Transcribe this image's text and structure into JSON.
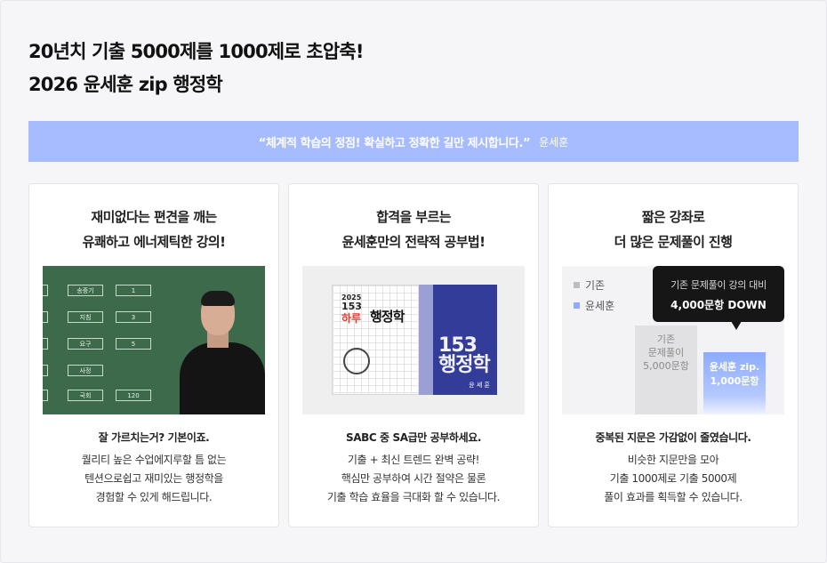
{
  "headline": {
    "line1": "20년치 기출 5000제를 1000제로 초압축!",
    "line2": "2026 윤세훈 zip 행정학"
  },
  "quote": {
    "text": "“체계적 학습의 정점! 확실하고 정확한 길만 제시합니다.”",
    "author": "윤세훈"
  },
  "colors": {
    "accent": "#a7bcff",
    "tooltip_bg": "#161616"
  },
  "cards": [
    {
      "title_lines": [
        "재미없다는 편견을 깨는",
        "유쾌하고 에너제틱한 강의!"
      ],
      "subtitle": "잘 가르치는거? 기본이죠.",
      "desc_lines": [
        "퀄리티 높은 수업에지루할 틈 없는",
        "텐션으로쉽고 재미있는 행정학을",
        "경험할 수 있게 해드립니다."
      ],
      "board": {
        "cells": [
          "송중기",
          "1",
          "지침",
          "3",
          "요구",
          "5",
          "사정",
          "국회",
          "120"
        ]
      }
    },
    {
      "title_lines": [
        "합격을 부르는",
        "윤세훈만의 전략적 공부법!"
      ],
      "subtitle": "SABC 중 SA급만 공부하세요.",
      "desc_lines": [
        "기출 + 최신 트렌드 완벽 공략!",
        "핵심만 공부하여 시간 절약은 물론",
        "기출 학습 효율을 극대화 할 수 있습니다."
      ],
      "book1": {
        "small": "2025",
        "number": "153",
        "red": "하루",
        "big": "행정학"
      },
      "book2": {
        "number": "153",
        "word": "행정학",
        "author": "윤 세 훈"
      }
    },
    {
      "title_lines": [
        "짧은 강좌로",
        "더 많은 문제풀이 진행"
      ],
      "subtitle": "중복된 지문은 가감없이 줄였습니다.",
      "desc_lines": [
        "비슷한 지문만을 모아",
        "기출 1000제로 기출 5000제",
        "풀이 효과를 획득할 수 있습니다."
      ],
      "comparison": {
        "legend": [
          {
            "label": "기존",
            "color": "#bdbdbd"
          },
          {
            "label": "윤세훈",
            "color": "#8dacff"
          }
        ],
        "bars": [
          {
            "lines": [
              "기존",
              "문제풀이",
              "5,000문항"
            ],
            "value": 5000
          },
          {
            "lines": [
              "윤세훈 zip.",
              "1,000문항"
            ],
            "value": 1000
          }
        ],
        "tooltip": {
          "line1": "기존 문제풀이 강의 대비",
          "line2": "4,000문항 DOWN"
        }
      }
    }
  ]
}
